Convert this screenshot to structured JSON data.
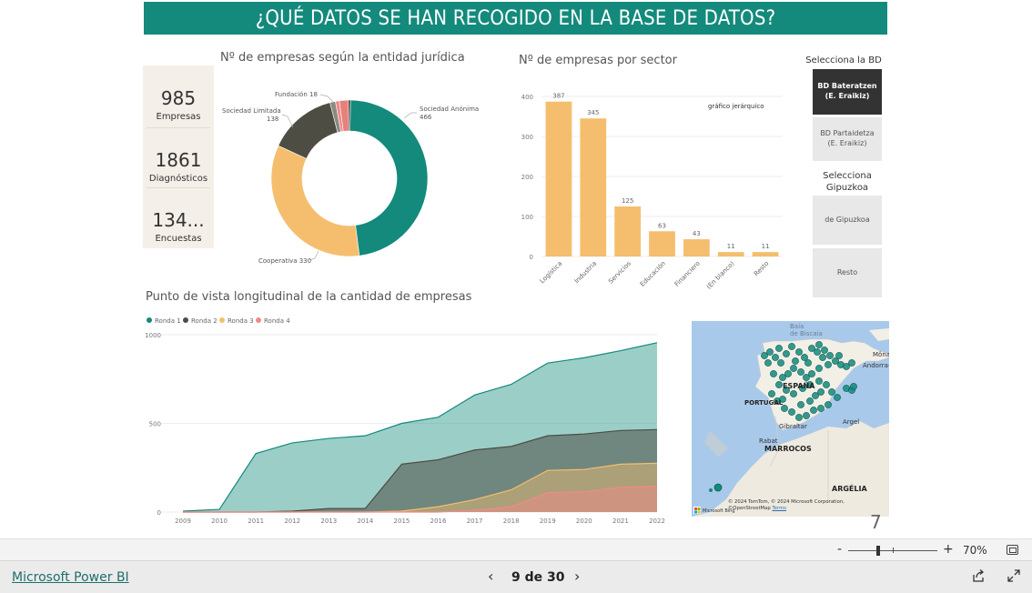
{
  "banner": {
    "title": "¿QUÉ DATOS SE HAN RECOGIDO EN LA BASE DE DATOS?"
  },
  "kpis": [
    {
      "value": "985",
      "label": "Empresas"
    },
    {
      "value": "1861",
      "label": "Diagnósticos"
    },
    {
      "value": "134...",
      "label": "Encuestas"
    }
  ],
  "titles": {
    "donut": "Nº de empresas según la entidad jurídica",
    "bar": "Nº de empresas por sector",
    "area": "Punto de vista longitudinal de la cantidad de empresas"
  },
  "slicers": {
    "bd_title": "Selecciona la BD",
    "bd_options": [
      "BD Bateratzen (E. Eraikiz)",
      "BD Partaidetza (E. Eraikiz)"
    ],
    "bd_selected": "BD Bateratzen (E. Eraikiz)",
    "gip_title": "Selecciona Gipuzkoa",
    "gip_options": [
      "de Gipuzkoa",
      "Resto"
    ]
  },
  "colors": {
    "teal": "#138a7c",
    "dark": "#4d4d44",
    "sand": "#f5be6e",
    "salmon": "#f08a8a",
    "bar": "#f5be6e",
    "active_slicer": "#333333"
  },
  "chart_data": [
    {
      "type": "pie",
      "title": "Nº de empresas según la entidad jurídica",
      "slices": [
        {
          "name": "Sociedad Anónima",
          "value": 466,
          "color": "#138a7c"
        },
        {
          "name": "Cooperativa",
          "value": 330,
          "color": "#f5be6e"
        },
        {
          "name": "Sociedad Limitada",
          "value": 138,
          "color": "#4d4d44"
        },
        {
          "name": "",
          "value": 11,
          "color": "#8a8a80"
        },
        {
          "name": "",
          "value": 8,
          "color": "#f08a8a"
        },
        {
          "name": "Fundación",
          "value": 18,
          "color": "#e8807a"
        },
        {
          "name": "",
          "value": 4,
          "color": "#333333"
        }
      ],
      "labels": [
        {
          "text": "Sociedad Anónima",
          "value": "466"
        },
        {
          "text": "Cooperativa 330"
        },
        {
          "text": "Sociedad Limitada",
          "value": "138"
        },
        {
          "text": "Fundación 18"
        }
      ]
    },
    {
      "type": "bar",
      "title": "Nº de empresas por sector",
      "categories": [
        "Logística",
        "Industria",
        "Servicios",
        "Educación",
        "Financiero",
        "(En blanco)",
        "Resto"
      ],
      "values": [
        387,
        345,
        125,
        63,
        43,
        11,
        11
      ],
      "ylim": [
        0,
        400
      ],
      "yticks": [
        0,
        100,
        200,
        300,
        400
      ],
      "annotation": "gráfico jerárquico",
      "grid": true
    },
    {
      "type": "area",
      "title": "Punto de vista longitudinal de la cantidad de empresas",
      "x": [
        2009,
        2010,
        2011,
        2012,
        2013,
        2014,
        2015,
        2016,
        2017,
        2018,
        2019,
        2020,
        2021,
        2022
      ],
      "ylim": [
        0,
        1000
      ],
      "yticks": [
        0,
        500,
        1000
      ],
      "legend": "top-left",
      "series": [
        {
          "name": "Ronda 1",
          "color": "#138a7c",
          "values": [
            5,
            15,
            330,
            390,
            415,
            430,
            500,
            535,
            660,
            720,
            840,
            870,
            910,
            955
          ]
        },
        {
          "name": "Ronda 2",
          "color": "#4d4d44",
          "values": [
            0,
            0,
            0,
            5,
            20,
            20,
            270,
            295,
            350,
            370,
            430,
            440,
            460,
            465
          ]
        },
        {
          "name": "Ronda 3",
          "color": "#f5be6e",
          "values": [
            0,
            0,
            0,
            0,
            0,
            0,
            5,
            30,
            70,
            125,
            235,
            240,
            270,
            275
          ]
        },
        {
          "name": "Ronda 4",
          "color": "#f08a8a",
          "values": [
            0,
            0,
            0,
            0,
            0,
            0,
            0,
            0,
            10,
            30,
            110,
            115,
            140,
            145
          ]
        }
      ]
    }
  ],
  "map": {
    "labels": [
      "Baia de Bizkaia",
      "Môna",
      "Andorra-a-Vella",
      "ESPAÑA",
      "PORTUGAL",
      "Gibraltar",
      "Argel",
      "Rabat",
      "MARROCOS",
      "ARGÉLIA"
    ],
    "attribution": "© 2024 TomTom, © 2024 Microsoft Corporation, ©OpenStreetMap",
    "terms": "Terms",
    "provider": "Microsoft Bing"
  },
  "page_number": "7",
  "zoom": {
    "value": "70%",
    "minus": "-",
    "plus": "+"
  },
  "footer": {
    "brand": "Microsoft Power BI",
    "page_indicator": "9 de 30",
    "prev": "‹",
    "next": "›"
  }
}
